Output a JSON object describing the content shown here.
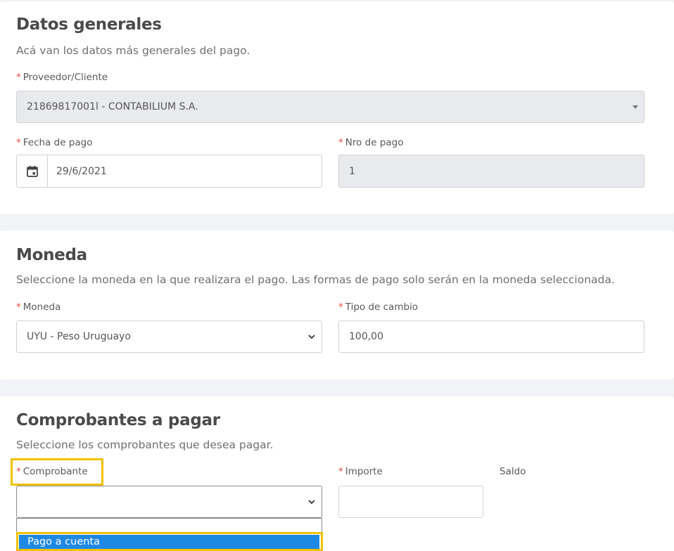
{
  "general": {
    "title": "Datos generales",
    "description": "Acá van los datos más generales del pago.",
    "required_mark": "*",
    "proveedor_label": "Proveedor/Cliente",
    "proveedor_value": "21869817001l - CONTABILIUM S.A.",
    "fecha_label": "Fecha de pago",
    "fecha_value": "29/6/2021",
    "nro_label": "Nro de pago",
    "nro_value": "1"
  },
  "moneda": {
    "title": "Moneda",
    "description": "Seleccione la moneda en la que realizara el pago. Las formas de pago solo serán en la moneda seleccionada.",
    "moneda_label": "Moneda",
    "moneda_value": "UYU - Peso Uruguayo",
    "tipo_cambio_label": "Tipo de cambio",
    "tipo_cambio_value": "100,00"
  },
  "comprobantes": {
    "title": "Comprobantes a pagar",
    "description": "Seleccione los comprobantes que desea pagar.",
    "comprobante_label": "Comprobante",
    "comprobante_value": "",
    "importe_label": "Importe",
    "importe_value": "",
    "saldo_label": "Saldo",
    "dropdown_options": [
      "",
      "Pago a cuenta"
    ],
    "selected_option": "Pago a cuenta"
  },
  "colors": {
    "required": "#e74c3c",
    "highlight": "#f2c200",
    "selected_option_bg": "#1e88e5",
    "disabled_bg": "#e9eaee"
  },
  "icons": [
    "calendar-icon",
    "caret-down-icon",
    "chevron-down-icon"
  ]
}
